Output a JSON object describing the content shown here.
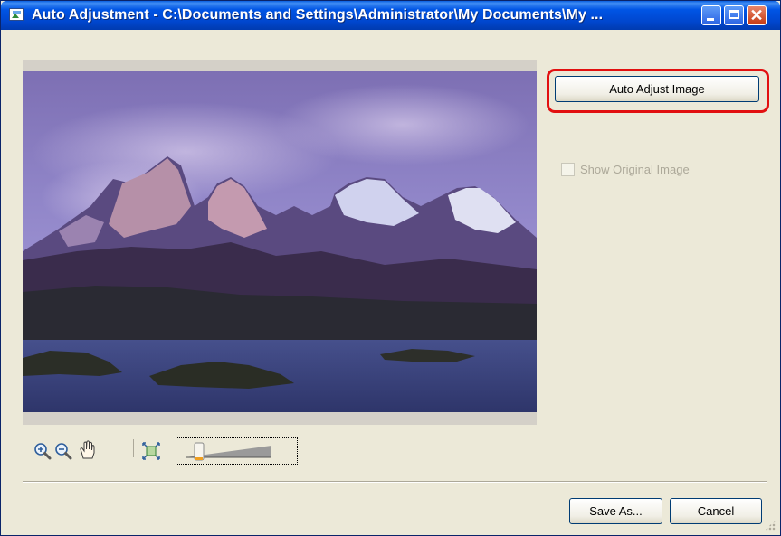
{
  "window": {
    "title": "Auto Adjustment - C:\\Documents and Settings\\Administrator\\My Documents\\My ...",
    "controls": [
      "minimize",
      "maximize",
      "close"
    ]
  },
  "preview": {
    "description": "mountain-lake-photo"
  },
  "actions": {
    "auto_adjust_label": "Auto Adjust Image",
    "highlight_color": "#e21010"
  },
  "options": {
    "show_original_label": "Show Original Image",
    "show_original_checked": false,
    "show_original_enabled": false
  },
  "toolbar": {
    "tools": [
      "zoom-in-icon",
      "zoom-out-icon",
      "hand-pan-icon",
      "fit-to-window-icon"
    ],
    "zoom_slider_level": 0.12
  },
  "footer": {
    "save_as_label": "Save As...",
    "cancel_label": "Cancel"
  }
}
